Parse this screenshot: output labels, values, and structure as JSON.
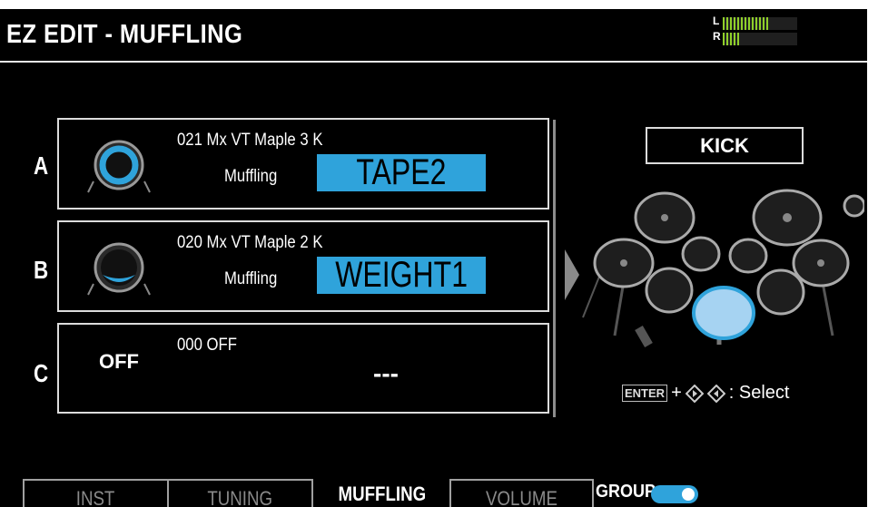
{
  "header": {
    "title": "EZ EDIT - MUFFLING",
    "meter": {
      "left_label": "L",
      "right_label": "R",
      "left_level": 0.64,
      "right_level": 0.22
    }
  },
  "rows": [
    {
      "letter": "A",
      "inst": "021 Mx VT Maple 3 K",
      "param_label": "Muffling",
      "value": "TAPE2",
      "icon": "drum-head-tape-icon"
    },
    {
      "letter": "B",
      "inst": "020 Mx VT Maple 2 K",
      "param_label": "Muffling",
      "value": "WEIGHT1",
      "icon": "drum-head-weight-icon"
    },
    {
      "letter": "C",
      "inst": "000 OFF",
      "status": "OFF",
      "value": "---"
    }
  ],
  "kit": {
    "selected": "KICK"
  },
  "hint": {
    "enter": "ENTER",
    "plus": "+",
    "suffix": ": Select"
  },
  "tabs": [
    {
      "label": "INST"
    },
    {
      "label": "TUNING"
    },
    {
      "label": "MUFFLING",
      "active": true
    },
    {
      "label": "VOLUME"
    }
  ],
  "group": {
    "label": "GROUP",
    "on": true
  },
  "colors": {
    "accent": "#2fa3db",
    "meter": "#8fcf2a",
    "background": "#000000"
  }
}
